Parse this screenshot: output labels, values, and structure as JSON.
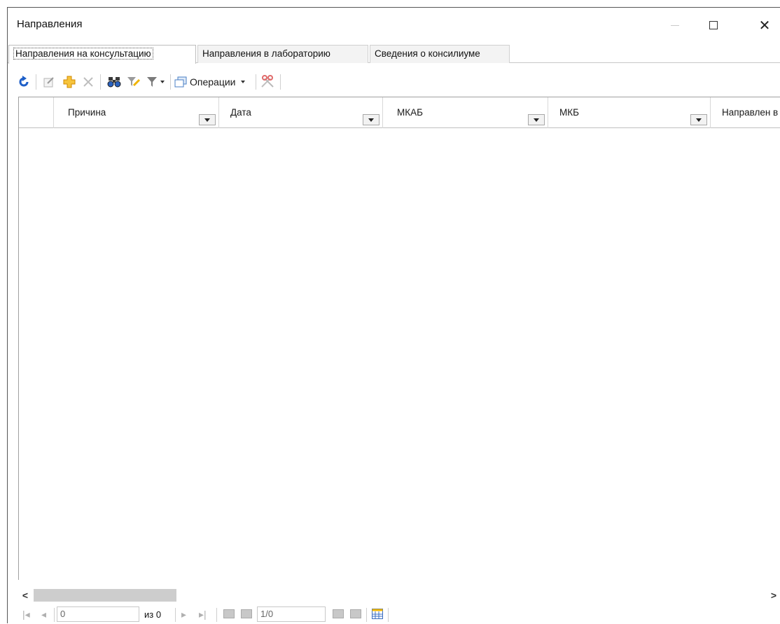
{
  "window": {
    "title": "Направления",
    "controls": {
      "minimize": "minimize",
      "maximize": "maximize",
      "close": "✕"
    }
  },
  "tabs": [
    {
      "label": "Направления на консультацию",
      "active": true
    },
    {
      "label": "Направления в лабораторию",
      "active": false
    },
    {
      "label": "Сведения о консилиуме",
      "active": false
    }
  ],
  "toolbar": {
    "operations_label": "Операции",
    "icons": [
      "refresh-icon",
      "edit-icon",
      "add-icon",
      "delete-icon",
      "search-binoculars-icon",
      "clear-filter-icon",
      "filter-icon",
      "operations-icon",
      "tools-icon"
    ],
    "colors": {
      "refresh": "#1e5fc8",
      "add": "#f0b400",
      "binoculars": "#2a62c0",
      "filter": "#7a7a7a"
    }
  },
  "grid": {
    "columns": [
      "Причина",
      "Дата",
      "МКАБ",
      "МКБ",
      "Направлен в"
    ],
    "rows": []
  },
  "pager": {
    "current_value": "0",
    "of_label": "из 0",
    "page_value": "1/0"
  },
  "scrollbar": {
    "left_arrow": "<",
    "right_arrow": ">"
  }
}
